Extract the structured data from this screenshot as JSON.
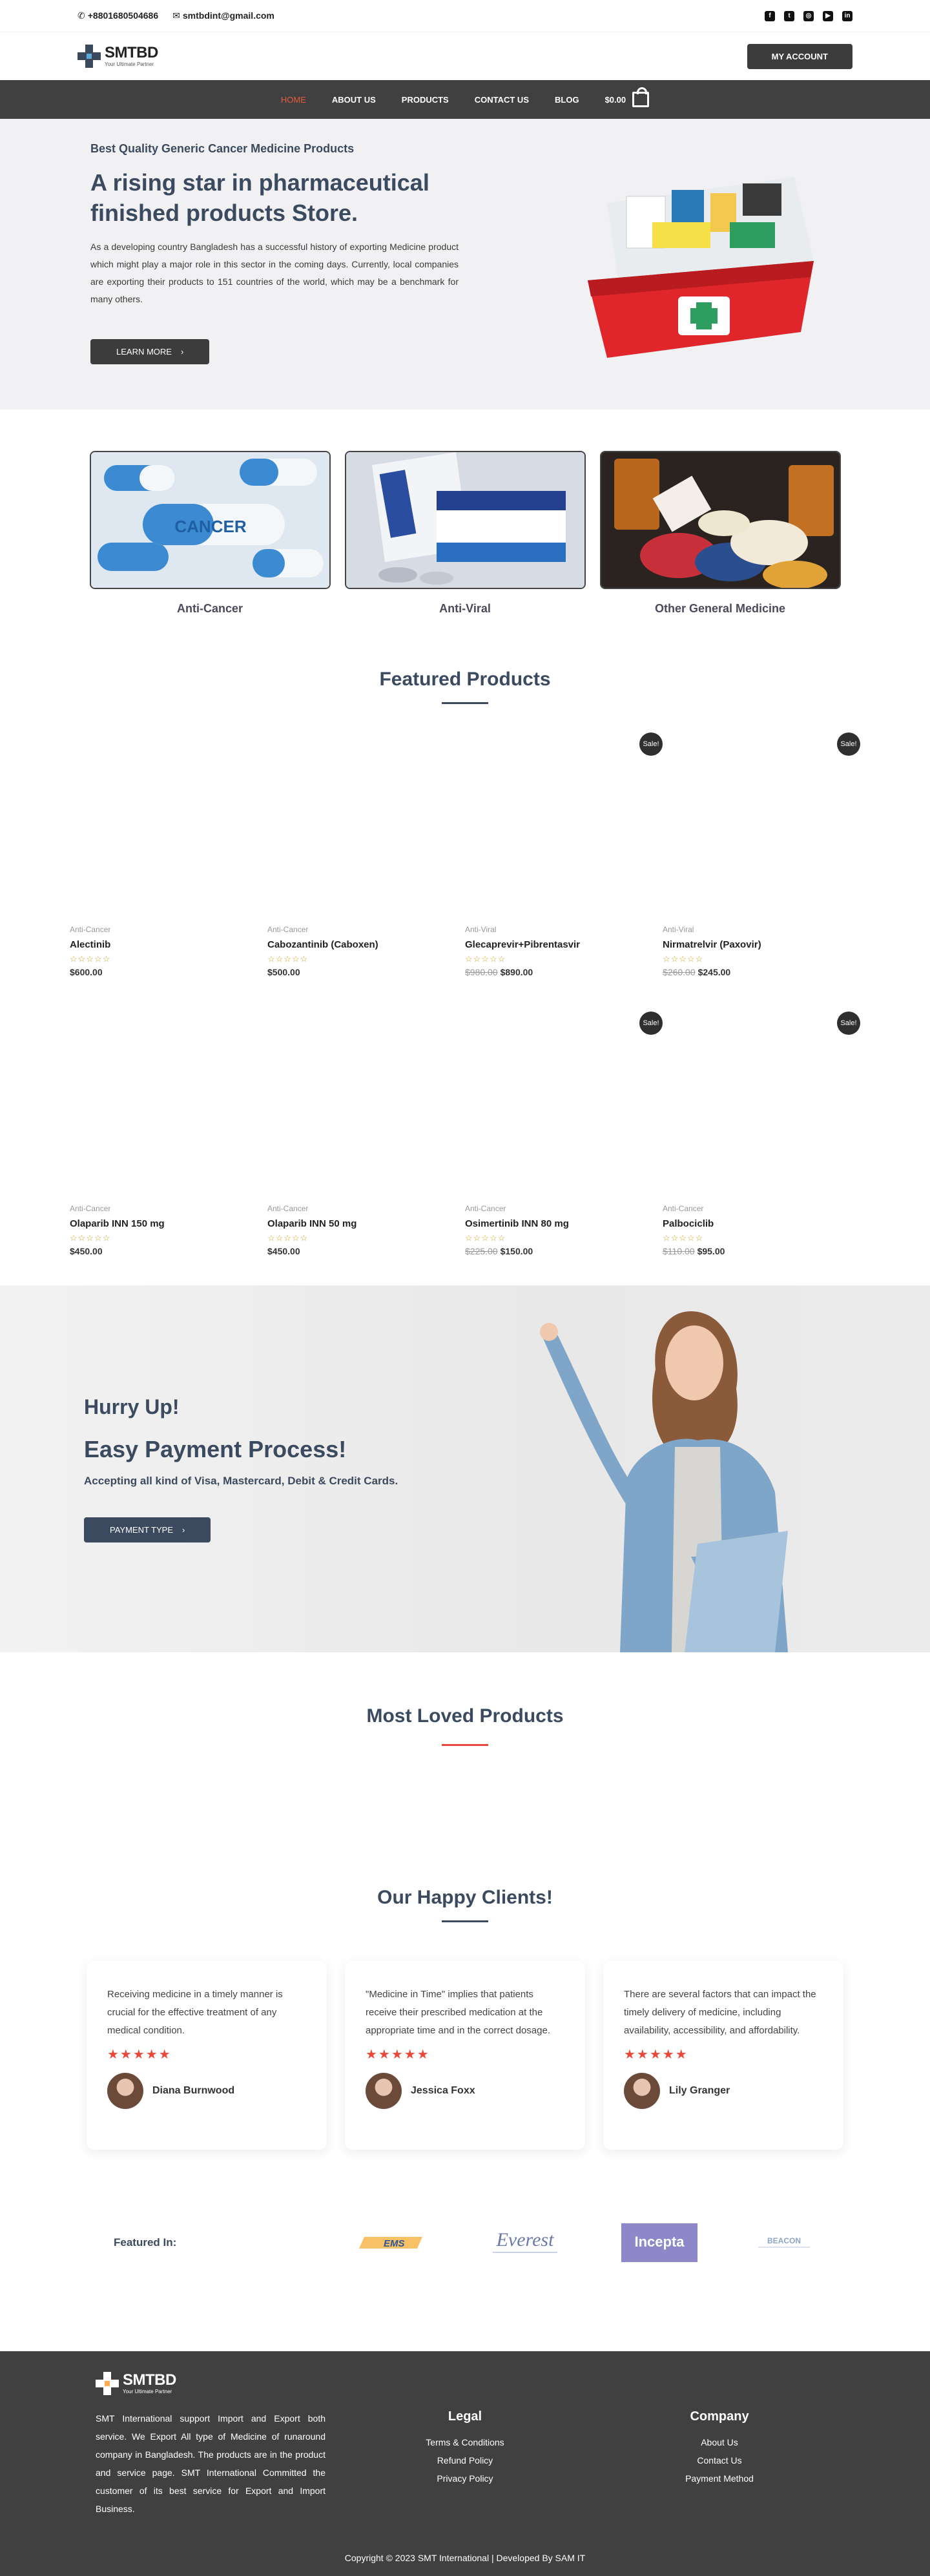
{
  "topbar": {
    "phone": "+8801680504686",
    "email": "smtbdint@gmail.com",
    "social": [
      "facebook-icon",
      "twitter-icon",
      "instagram-icon",
      "youtube-icon",
      "linkedin-icon"
    ]
  },
  "header": {
    "logo_name": "SMTBD",
    "logo_tagline": "Your Ultimate Partner",
    "account_label": "MY ACCOUNT"
  },
  "nav": {
    "items": [
      "HOME",
      "ABOUT US",
      "PRODUCTS",
      "CONTACT US",
      "BLOG"
    ],
    "cart_total": "$0.00"
  },
  "hero": {
    "eyebrow": "Best Quality Generic Cancer Medicine Products",
    "title": "A rising star in pharmaceutical finished products Store.",
    "body": "As a developing country Bangladesh has a successful history of exporting Medicine product which might play a major role in this sector in the coming days. Currently, local companies are exporting their products to 151 countries of the world, which may be a benchmark for many others.",
    "button": "LEARN MORE"
  },
  "categories": [
    {
      "name": "Anti-Cancer"
    },
    {
      "name": "Anti-Viral"
    },
    {
      "name": "Other General Medicine"
    }
  ],
  "featured": {
    "title": "Featured Products",
    "sale_label": "Sale!",
    "products": [
      {
        "category": "Anti-Cancer",
        "name": "Alectinib",
        "old_price": "",
        "price": "$600.00",
        "sale": false
      },
      {
        "category": "Anti-Cancer",
        "name": "Cabozantinib (Caboxen)",
        "old_price": "",
        "price": "$500.00",
        "sale": false
      },
      {
        "category": "Anti-Viral",
        "name": "Glecaprevir+Pibrentasvir",
        "old_price": "$980.00",
        "price": "$890.00",
        "sale": true
      },
      {
        "category": "Anti-Viral",
        "name": "Nirmatrelvir (Paxovir)",
        "old_price": "$260.00",
        "price": "$245.00",
        "sale": true
      },
      {
        "category": "Anti-Cancer",
        "name": "Olaparib INN 150 mg",
        "old_price": "",
        "price": "$450.00",
        "sale": false
      },
      {
        "category": "Anti-Cancer",
        "name": "Olaparib INN 50 mg",
        "old_price": "",
        "price": "$450.00",
        "sale": false
      },
      {
        "category": "Anti-Cancer",
        "name": "Osimertinib INN 80 mg",
        "old_price": "$225.00",
        "price": "$150.00",
        "sale": true
      },
      {
        "category": "Anti-Cancer",
        "name": "Palbociclib",
        "old_price": "$110.00",
        "price": "$95.00",
        "sale": true
      }
    ]
  },
  "promo": {
    "line1": "Hurry Up!",
    "line2": "Easy Payment Process!",
    "line3": "Accepting all kind of Visa, Mastercard, Debit & Credit Cards.",
    "button": "PAYMENT TYPE"
  },
  "most_loved": {
    "title": "Most Loved Products"
  },
  "clients": {
    "title": "Our Happy Clients!",
    "items": [
      {
        "quote": "Receiving medicine in a timely manner is crucial for the effective treatment of any medical condition.",
        "name": "Diana Burnwood",
        "rating": 5
      },
      {
        "quote": "\"Medicine in Time\" implies that patients receive their prescribed medication at the appropriate time and in the correct dosage.",
        "name": "Jessica Foxx",
        "rating": 5
      },
      {
        "quote": "There are several factors that can impact the timely delivery of medicine, including availability, accessibility, and affordability.",
        "name": "Lily Granger",
        "rating": 5
      }
    ]
  },
  "featured_in": {
    "label": "Featured In:",
    "logos": [
      "EMS",
      "Everest",
      "Incepta",
      "BEACON"
    ]
  },
  "footer": {
    "about": "SMT International support Import and Export both service. We Export All type of Medicine of runaround company in Bangladesh. The products are in the product and service page. SMT International Committed the customer of its best service for Export and Import Business.",
    "legal_title": "Legal",
    "legal": [
      "Terms & Conditions",
      "Refund Policy",
      "Privacy Policy"
    ],
    "company_title": "Company",
    "company": [
      "About Us",
      "Contact Us",
      "Payment Method"
    ],
    "copyright": "Copyright © 2023 SMT International | Developed By SAM IT"
  },
  "colors": {
    "primary": "#3b4a5e",
    "accent": "#e85a3c",
    "dark": "#404040",
    "star": "#e8493a"
  }
}
